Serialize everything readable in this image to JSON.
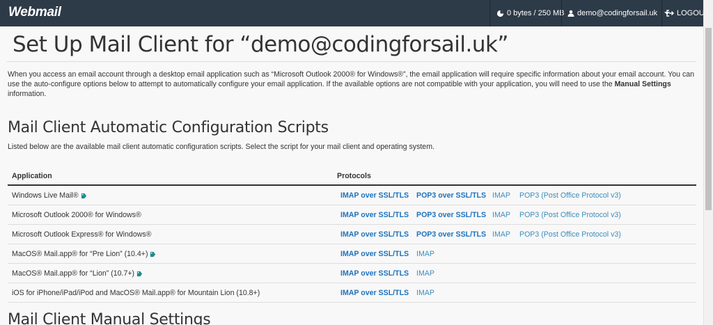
{
  "topbar": {
    "logo": "Webmail",
    "quota": "0 bytes / 250 MB",
    "user": "demo@codingforsail.uk",
    "logout": "LOGOUT"
  },
  "page": {
    "title": "Set Up Mail Client for “demo@codingforsail.uk”",
    "intro_part1": "When you access an email account through a desktop email application such as “Microsoft Outlook 2000® for Windows®”, the email application will require specific information about your email account. You can use the auto-configure options below to attempt to automatically configure your email application. If the available options are not compatible with your application, you will need to use the ",
    "intro_bold": "Manual Settings",
    "intro_part2": " information."
  },
  "auto": {
    "heading": "Mail Client Automatic Configuration Scripts",
    "description": "Listed below are the available mail client automatic configuration scripts. Select the script for your mail client and operating system.",
    "col_application": "Application",
    "col_protocols": "Protocols",
    "rows": [
      {
        "app": "Windows Live Mail®",
        "p1": "IMAP over SSL/TLS",
        "p2": "POP3 over SSL/TLS",
        "p3": "IMAP",
        "p4": "POP3 (Post Office Protocol v3)"
      },
      {
        "app": "Microsoft Outlook 2000® for Windows®",
        "p1": "IMAP over SSL/TLS",
        "p2": "POP3 over SSL/TLS",
        "p3": "IMAP",
        "p4": "POP3 (Post Office Protocol v3)"
      },
      {
        "app": "Microsoft Outlook Express® for Windows®",
        "p1": "IMAP over SSL/TLS",
        "p2": "POP3 over SSL/TLS",
        "p3": "IMAP",
        "p4": "POP3 (Post Office Protocol v3)"
      },
      {
        "app": "MacOS® Mail.app® for “Pre Lion” (10.4+)",
        "p1": "IMAP over SSL/TLS",
        "p2": "IMAP"
      },
      {
        "app": "MacOS® Mail.app® for “Lion” (10.7+)",
        "p1": "IMAP over SSL/TLS",
        "p2": "IMAP"
      },
      {
        "app": "iOS for iPhone/iPad/iPod and MacOS® Mail.app® for Mountain Lion (10.8+)",
        "p1": "IMAP over SSL/TLS",
        "p2": "IMAP"
      }
    ]
  },
  "manual": {
    "heading": "Mail Client Manual Settings"
  },
  "colors": {
    "topbar": "#2d3a48",
    "link": "#1e73be",
    "tag_icon": "#1f8c8c"
  }
}
